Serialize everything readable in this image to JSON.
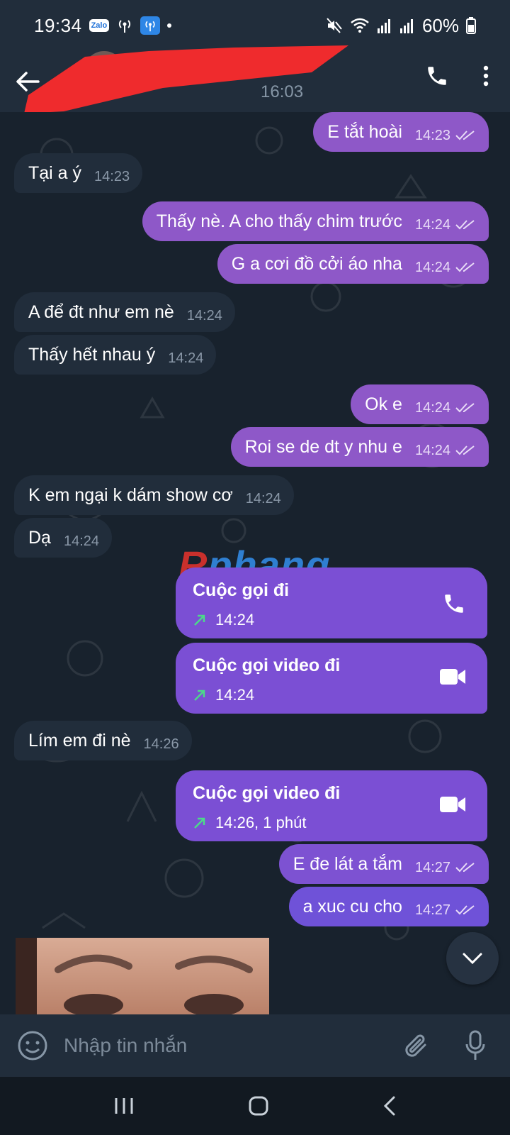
{
  "status_bar": {
    "time": "19:34",
    "zalo_badge": "Zalo",
    "battery": "60%"
  },
  "header": {
    "subtitle": "16:03"
  },
  "messages": [
    {
      "dir": "out",
      "text": "E tắt hoài",
      "time": "14:23"
    },
    {
      "dir": "in",
      "text": "Tại a ý",
      "time": "14:23"
    },
    {
      "dir": "out",
      "text": "Thấy nè. A cho thấy chim trước",
      "time": "14:24"
    },
    {
      "dir": "out",
      "text": "G a cơi đồ cởi áo nha",
      "time": "14:24"
    },
    {
      "dir": "in",
      "text": "A để đt như em nè",
      "time": "14:24"
    },
    {
      "dir": "in",
      "text": "Thấy hết nhau ý",
      "time": "14:24"
    },
    {
      "dir": "out",
      "text": "Ok e",
      "time": "14:24"
    },
    {
      "dir": "out",
      "text": "Roi se de dt y nhu e",
      "time": "14:24"
    },
    {
      "dir": "in",
      "text": "K em ngại k dám show cơ",
      "time": "14:24"
    },
    {
      "dir": "in",
      "text": "Dạ",
      "time": "14:24"
    }
  ],
  "calls": [
    {
      "title": "Cuộc gọi đi",
      "meta": "14:24",
      "icon": "phone-icon"
    },
    {
      "title": "Cuộc gọi video đi",
      "meta": "14:24",
      "icon": "video-icon"
    },
    {
      "title": "Cuộc gọi video đi",
      "meta": "14:26, 1 phút",
      "icon": "video-icon"
    }
  ],
  "messages2": [
    {
      "dir": "in",
      "text": "Lím em đi nè",
      "time": "14:26"
    },
    {
      "dir": "out",
      "text": "E đe lát a tắm",
      "time": "14:27"
    },
    {
      "dir": "out",
      "text": "a xuc cu cho",
      "time": "14:27"
    }
  ],
  "watermark": {
    "first": "R",
    "rest": "phang"
  },
  "composer": {
    "placeholder": "Nhập tin nhắn"
  },
  "colors": {
    "bg": "#18222d",
    "incoming": "#212d3b",
    "outgoing": "#8e58c8",
    "call": "#7b4fd4",
    "arrow": "#4cd98a"
  }
}
